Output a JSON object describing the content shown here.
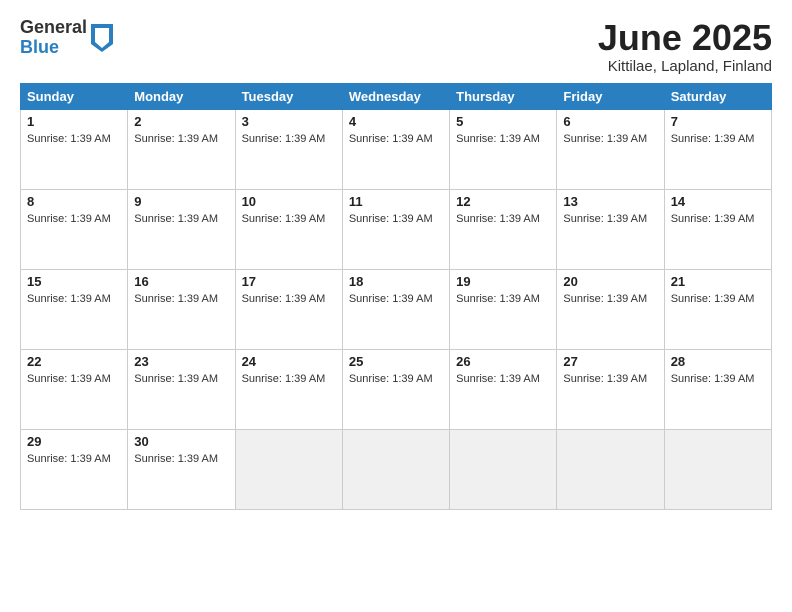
{
  "logo": {
    "general": "General",
    "blue": "Blue"
  },
  "title": "June 2025",
  "location": "Kittilae, Lapland, Finland",
  "days_of_week": [
    "Sunday",
    "Monday",
    "Tuesday",
    "Wednesday",
    "Thursday",
    "Friday",
    "Saturday"
  ],
  "sunrise_text": "Sunrise: 1:39 AM",
  "weeks": [
    [
      {
        "day": "1",
        "empty": false
      },
      {
        "day": "2",
        "empty": false
      },
      {
        "day": "3",
        "empty": false
      },
      {
        "day": "4",
        "empty": false
      },
      {
        "day": "5",
        "empty": false
      },
      {
        "day": "6",
        "empty": false
      },
      {
        "day": "7",
        "empty": false
      }
    ],
    [
      {
        "day": "8",
        "empty": false
      },
      {
        "day": "9",
        "empty": false
      },
      {
        "day": "10",
        "empty": false
      },
      {
        "day": "11",
        "empty": false
      },
      {
        "day": "12",
        "empty": false
      },
      {
        "day": "13",
        "empty": false
      },
      {
        "day": "14",
        "empty": false
      }
    ],
    [
      {
        "day": "15",
        "empty": false
      },
      {
        "day": "16",
        "empty": false
      },
      {
        "day": "17",
        "empty": false
      },
      {
        "day": "18",
        "empty": false
      },
      {
        "day": "19",
        "empty": false
      },
      {
        "day": "20",
        "empty": false
      },
      {
        "day": "21",
        "empty": false
      }
    ],
    [
      {
        "day": "22",
        "empty": false
      },
      {
        "day": "23",
        "empty": false
      },
      {
        "day": "24",
        "empty": false
      },
      {
        "day": "25",
        "empty": false
      },
      {
        "day": "26",
        "empty": false
      },
      {
        "day": "27",
        "empty": false
      },
      {
        "day": "28",
        "empty": false
      }
    ],
    [
      {
        "day": "29",
        "empty": false
      },
      {
        "day": "30",
        "empty": false
      },
      {
        "day": "",
        "empty": true
      },
      {
        "day": "",
        "empty": true
      },
      {
        "day": "",
        "empty": true
      },
      {
        "day": "",
        "empty": true
      },
      {
        "day": "",
        "empty": true
      }
    ]
  ]
}
